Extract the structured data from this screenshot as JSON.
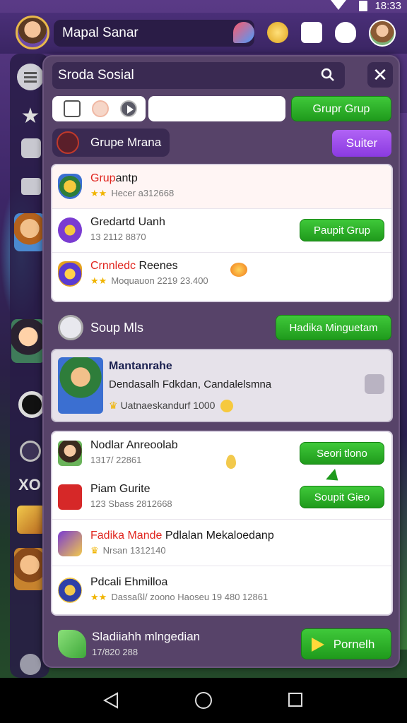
{
  "status_bar": {
    "time": "18:33"
  },
  "header": {
    "username": "Mapal Sanar"
  },
  "panel": {
    "search_text": "Sroda Sosial",
    "close_label": "✕",
    "filter_button": "Grupr Grup",
    "group_tag": "Grupe Mrana",
    "purple_button": "Suiter"
  },
  "groups": [
    {
      "title_red": "Grup",
      "title_rest": "antp",
      "sub": "Hecer a312668",
      "button": ""
    },
    {
      "title_red": "",
      "title_rest": "Gredartd Uanh",
      "sub": "13 2112 8870",
      "button": "Paupit Grup"
    },
    {
      "title_red": "Crnnledc",
      "title_rest": " Reenes",
      "sub": "Moquauon 2219 23.400",
      "button": ""
    }
  ],
  "section2": {
    "title": "Soup Mls",
    "button": "Hadika Minguetam"
  },
  "featured": {
    "title": "Mantanrahe",
    "desc": "Dendasalh Fdkdan, Candalelsmna",
    "meta": "Uatnaeskandurf 1000"
  },
  "groups2": [
    {
      "title_red": "",
      "title_rest": "Nodlar Anreoolab",
      "sub": "1317/ 22861",
      "button": "Seori tlono"
    },
    {
      "title_red": "",
      "title_rest": "Piam Gurite",
      "sub": "123 Sbass 2812668",
      "button": "Soupit Gieo"
    },
    {
      "title_red": "Fadika Mande",
      "title_rest": " Pdlalan Mekaloedanp",
      "sub": "Nrsan 1312140",
      "button": ""
    },
    {
      "title_red": "",
      "title_rest": "Pdcali Ehmilloa",
      "sub": "Dassaßl/ zoono Haoseu 19 480 12861",
      "button": ""
    }
  ],
  "bottom": {
    "title": "Sladiiahh mlngedian",
    "sub": "17/820 288",
    "button": "Pornelh"
  },
  "colors": {
    "accent_green": "#2bb52a",
    "accent_purple": "#9b4cf0",
    "panel_bg": "#574369"
  }
}
